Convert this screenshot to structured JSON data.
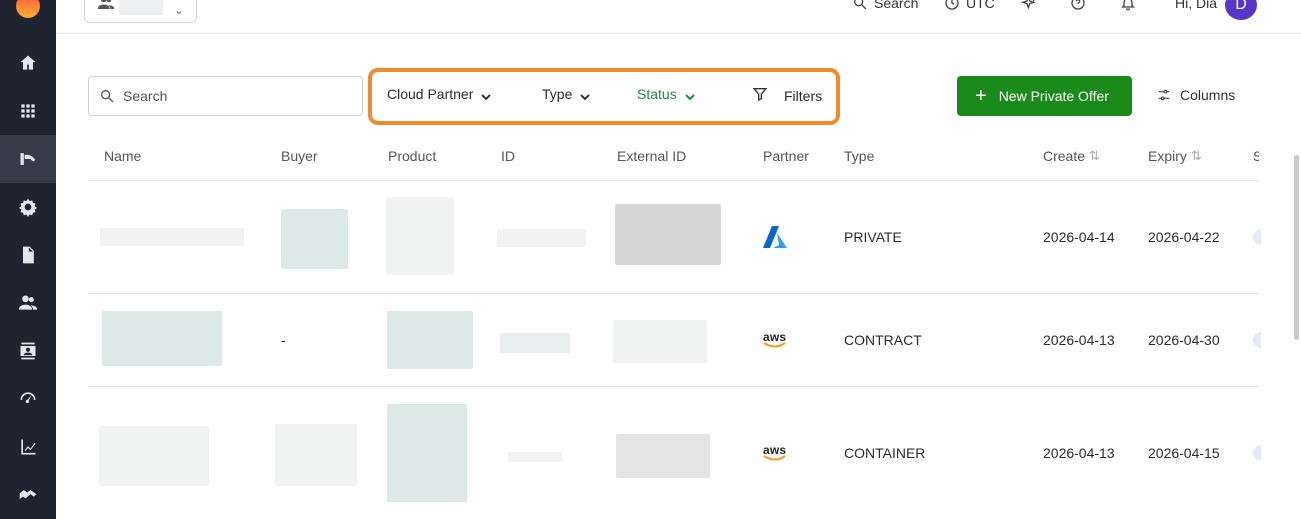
{
  "header": {
    "search_label": "Search",
    "timezone_label": "UTC",
    "greeting": "Hi, Dia",
    "avatar_initial": "D"
  },
  "sidebar": {
    "items": [
      {
        "icon": "home-icon"
      },
      {
        "icon": "apps-grid-icon"
      },
      {
        "icon": "offers-icon",
        "active": true
      },
      {
        "icon": "gear-icon"
      },
      {
        "icon": "document-icon"
      },
      {
        "icon": "people-icon"
      },
      {
        "icon": "contacts-icon"
      },
      {
        "icon": "speedometer-icon"
      },
      {
        "icon": "analytics-icon"
      },
      {
        "icon": "handshake-icon"
      }
    ]
  },
  "toolbar": {
    "search_placeholder": "Search",
    "filters": {
      "cloud_partner": "Cloud Partner",
      "type": "Type",
      "status": "Status",
      "filters": "Filters"
    },
    "new_offer_label": "New Private Offer",
    "columns_label": "Columns",
    "accent_color": "#f08a2c",
    "primary_color": "#1a8a1a",
    "status_color": "#1e8a3c"
  },
  "table": {
    "columns": [
      "Name",
      "Buyer",
      "Product",
      "ID",
      "External ID",
      "Partner",
      "Type",
      "Create",
      "Expiry",
      "S"
    ],
    "rows": [
      {
        "buyer": "",
        "partner": "azure",
        "type": "PRIVATE",
        "create": "2026-04-14",
        "expiry": "2026-04-22"
      },
      {
        "buyer": "-",
        "partner": "aws",
        "type": "CONTRACT",
        "create": "2026-04-13",
        "expiry": "2026-04-30"
      },
      {
        "buyer": "",
        "partner": "aws",
        "type": "CONTAINER",
        "create": "2026-04-13",
        "expiry": "2026-04-15"
      }
    ],
    "aws_logo_text": "aws"
  }
}
